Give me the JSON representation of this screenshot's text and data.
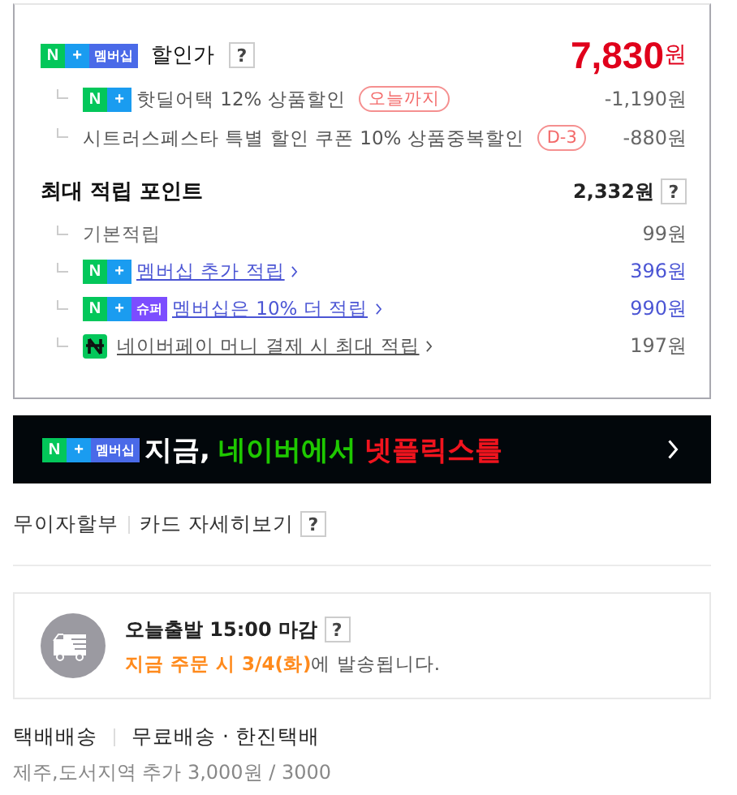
{
  "price": {
    "badges": [
      {
        "kind": "n",
        "text": "N"
      },
      {
        "kind": "plus",
        "text": "+"
      },
      {
        "kind": "member",
        "text": "멤버십"
      }
    ],
    "label": "할인가",
    "help": "?",
    "amount": "7,830",
    "unit": "원",
    "discounts": [
      {
        "badges": [
          {
            "kind": "n",
            "text": "N"
          },
          {
            "kind": "plus",
            "text": "+"
          }
        ],
        "text": "핫딜어택 12% 상품할인",
        "tag": "오늘까지",
        "value": "-1,190원"
      },
      {
        "text": "시트러스페스타 특별 할인 쿠폰 10% 상품중복할인",
        "tag": "D-3",
        "value": "-880원"
      }
    ]
  },
  "points": {
    "label": "최대 적립 포인트",
    "amount": "2,332원",
    "help": "?",
    "rows": [
      {
        "kind": "plain",
        "badges": [],
        "text": "기본적립",
        "value": "99원"
      },
      {
        "kind": "member",
        "badges": [
          {
            "kind": "n",
            "text": "N"
          },
          {
            "kind": "plus",
            "text": "+"
          }
        ],
        "text": "멤버십 추가 적립",
        "value": "396원"
      },
      {
        "kind": "member",
        "badges": [
          {
            "kind": "n",
            "text": "N"
          },
          {
            "kind": "plus",
            "text": "+"
          },
          {
            "kind": "super",
            "text": "슈퍼"
          }
        ],
        "text": "멤버십은 10% 더 적립",
        "value": "990원"
      },
      {
        "kind": "pay",
        "badges": [
          {
            "kind": "pay"
          }
        ],
        "text": "네이버페이 머니 결제 시 최대 적립",
        "value": "197원"
      }
    ]
  },
  "banner": {
    "badges": [
      {
        "kind": "n",
        "text": "N"
      },
      {
        "kind": "plus",
        "text": "+"
      },
      {
        "kind": "member",
        "text": "멤버십"
      }
    ],
    "parts": [
      {
        "text": "지금,",
        "color": "#ffffff"
      },
      {
        "text": "네이버에서",
        "color": "#1ec800"
      },
      {
        "text": "넷플릭스를",
        "color": "#f0141e"
      }
    ]
  },
  "card": {
    "items": [
      "무이자할부",
      "카드 자세히보기"
    ],
    "help": "?"
  },
  "shipping_notice": {
    "title": "오늘출발 15:00 마감",
    "help": "?",
    "highlight": "지금 주문 시 3/4(화)",
    "rest": "에 발송됩니다."
  },
  "delivery": {
    "method": "택배배송",
    "info": "무료배송 · 한진택배",
    "extra": "제주,도서지역 추가 3,000원 / 3000"
  }
}
